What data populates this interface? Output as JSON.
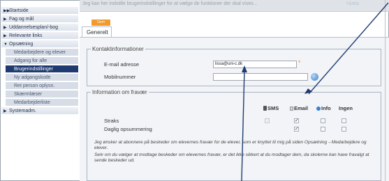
{
  "topbar": {
    "text": "Jeg kan her indstille brugerindstillinger for at vælge de funktioner der skal vises...",
    "link": "Hjælp"
  },
  "toolbar": {
    "save_label": "Gem"
  },
  "sidebar": {
    "items": [
      {
        "label": "Startside",
        "arrow": "▶▶"
      },
      {
        "label": "Fag og mål",
        "arrow": "▶"
      },
      {
        "label": "Uddannelsesplan/-bog",
        "arrow": "▶"
      },
      {
        "label": "Relevante links",
        "arrow": "▶"
      },
      {
        "label": "Opsætning",
        "arrow": "▼"
      }
    ],
    "subitems": [
      {
        "label": "Medarbejdere og elever"
      },
      {
        "label": "Adgang for alle"
      },
      {
        "label": "Brugerindstillinger"
      },
      {
        "label": "Ny adgangskode"
      },
      {
        "label": "Ret person oplysn."
      },
      {
        "label": "Skærmlæser"
      },
      {
        "label": "Medarbejderliste"
      }
    ],
    "last_item": {
      "label": "Systemadm.",
      "arrow": "▶"
    }
  },
  "tabs": [
    {
      "label": "Generelt"
    }
  ],
  "contact": {
    "legend": "Kontaktinformationer",
    "email_label": "E-mail adresse",
    "email_value": "lissa@uni-c.dk",
    "mobile_label": "Mobilnummer",
    "mobile_value": ""
  },
  "absence": {
    "legend": "Information om fravær",
    "headers": [
      "SMS",
      "Email",
      "Info",
      "Ingen"
    ],
    "rows": [
      {
        "label": "Straks",
        "checks": [
          false,
          true,
          false,
          false
        ]
      },
      {
        "label": "Daglig opsummering",
        "checks": [
          false,
          true,
          false,
          false
        ]
      }
    ],
    "note1": "Jeg ønsker at abonnere på beskeder om elevernes fravær for de elever, som er knyttet til mig på siden Opsætning→Medarbejdere og elever.",
    "note2": "Selv om du vælger at modtage beskeder om elevernes fravær, er det ikke sikkert at du modtager dem, da skolerne kan have fravalgt at sende beskeder ud."
  },
  "colors": {
    "accent": "#f39a2c",
    "nav_active": "#1f3a70",
    "callout": "#1f3a70"
  }
}
